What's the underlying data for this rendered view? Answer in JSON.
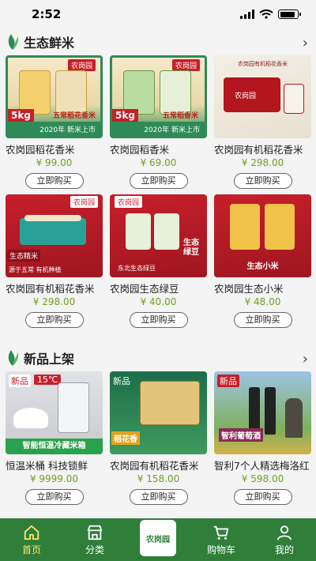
{
  "status": {
    "time": "2:52"
  },
  "sections": [
    {
      "title": "生态鲜米",
      "products": [
        {
          "name": "农岗园稻花香米",
          "price": "¥ 99.00",
          "buy": "立即购买",
          "thumb_text": "5kg",
          "thumb_sub": "五常稻花香米",
          "thumb_year": "2020年 新米上市"
        },
        {
          "name": "农岗园稻香米",
          "price": "¥ 69.00",
          "buy": "立即购买",
          "thumb_text": "5kg",
          "thumb_sub": "五常稻香米",
          "thumb_year": "2020年 新米上市"
        },
        {
          "name": "农岗园有机稻花香米",
          "price": "¥ 298.00",
          "buy": "立即购买",
          "thumb_text": "农岗园有机稻花香米"
        },
        {
          "name": "农岗园有机稻花香米",
          "price": "¥ 298.00",
          "buy": "立即购买",
          "thumb_text": "生态精米",
          "thumb_sub": "源于五常 有机种植"
        },
        {
          "name": "农岗园生态绿豆",
          "price": "¥ 40.00",
          "buy": "立即购买",
          "thumb_text": "生态绿豆",
          "thumb_sub": "东北生态绿豆"
        },
        {
          "name": "农岗园生态小米",
          "price": "¥ 48.00",
          "buy": "立即购买",
          "thumb_text": "生态小米"
        }
      ]
    },
    {
      "title": "新品上架",
      "products": [
        {
          "name": "恒温米桶 科技锁鲜",
          "price": "¥ 9999.00",
          "buy": "立即购买",
          "thumb_text": "新品",
          "thumb_sub": "智能恒温冷藏米箱",
          "thumb_temp": "15℃"
        },
        {
          "name": "农岗园有机稻花香米",
          "price": "¥ 158.00",
          "buy": "立即购买",
          "thumb_text": "新品",
          "thumb_sub": "稻花香"
        },
        {
          "name": "智利7个人精选梅洛红",
          "price": "¥ 598.00",
          "buy": "立即购买",
          "thumb_text": "新品",
          "thumb_sub": "智利葡萄酒"
        }
      ]
    }
  ],
  "brand": "农岗园",
  "tabs": [
    {
      "label": "首页",
      "icon": "home-icon",
      "active": true
    },
    {
      "label": "分类",
      "icon": "shop-icon"
    },
    {
      "label": "",
      "icon": "brand-logo"
    },
    {
      "label": "购物车",
      "icon": "cart-icon"
    },
    {
      "label": "我的",
      "icon": "user-icon"
    }
  ],
  "colors": {
    "accent_green": "#2f7f3b",
    "price_green": "#6aa31e",
    "brand_red": "#c71f2a",
    "active_tab": "#ffe56b"
  }
}
